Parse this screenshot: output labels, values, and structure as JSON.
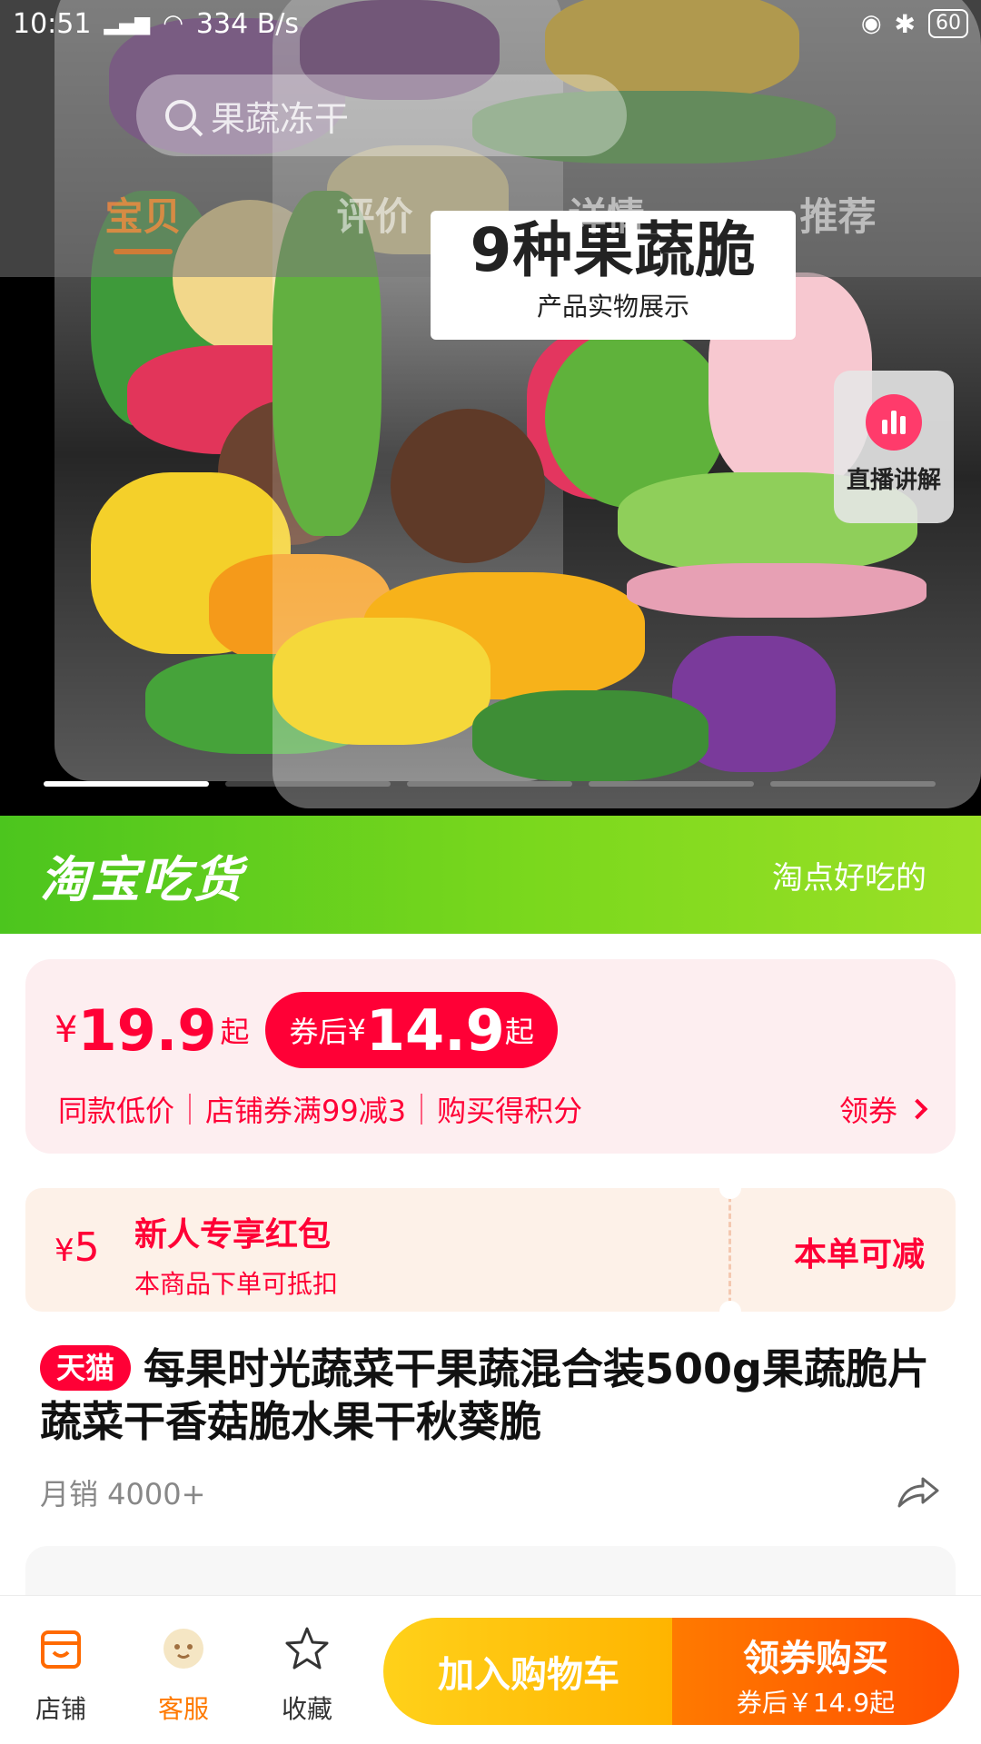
{
  "status": {
    "time": "10:51",
    "network": "4G",
    "speed": "334 B/s",
    "battery": "60"
  },
  "search": {
    "placeholder": "果蔬冻干"
  },
  "tabs": [
    {
      "label": "宝贝"
    },
    {
      "label": "评价"
    },
    {
      "label": "详情"
    },
    {
      "label": "推荐"
    }
  ],
  "hero": {
    "title": "9种果蔬脆",
    "subtitle": "产品实物展示",
    "page_count": 5,
    "current_page": 1
  },
  "live": {
    "label": "直播讲解"
  },
  "banner": {
    "logo": "淘宝吃货",
    "slogan": "淘点好吃的"
  },
  "price": {
    "currency": "¥",
    "original": "19.9",
    "suffix": "起",
    "coupon_label": "券后",
    "coupon_price": "14.9",
    "promos": [
      "同款低价",
      "店铺券满99减3",
      "购买得积分"
    ],
    "get_coupon": "领券"
  },
  "red_packet": {
    "currency": "¥",
    "amount": "5",
    "title": "新人专享红包",
    "subtitle": "本商品下单可抵扣",
    "action": "本单可减"
  },
  "product": {
    "badge": "天猫",
    "title": "每果时光蔬菜干果蔬混合装500g果蔬脆片蔬菜干香菇脆水果干秋葵脆",
    "sales": "月销 4000+"
  },
  "bottom": {
    "shop": "店铺",
    "service": "客服",
    "favorite": "收藏",
    "add_to_cart": "加入购物车",
    "buy": "领券购买",
    "buy_sub": "券后￥14.9起"
  },
  "colors": {
    "accent_red": "#ff0036",
    "accent_orange": "#ff5000",
    "banner_green": "#6fd01f"
  }
}
